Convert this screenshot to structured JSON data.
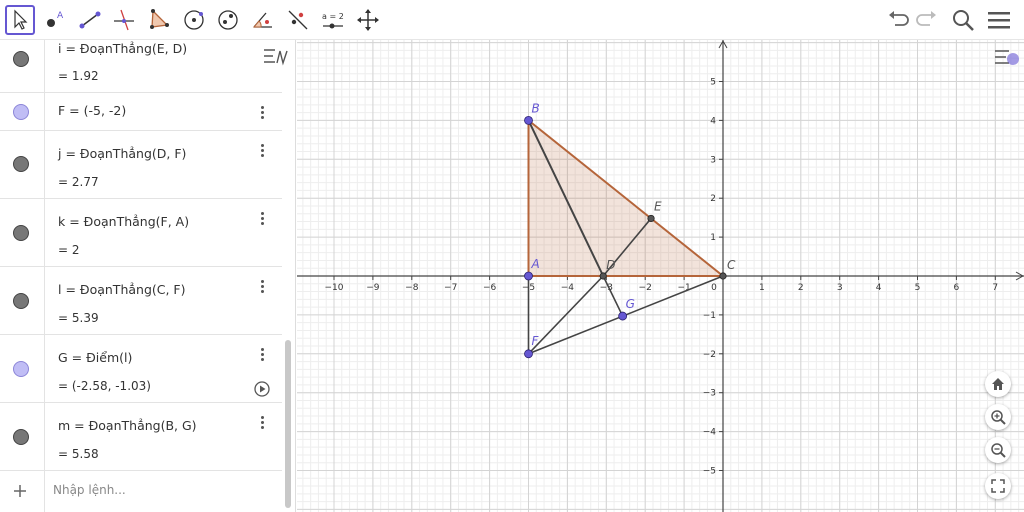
{
  "toolbar": {
    "tools": [
      "move-tool",
      "point-tool",
      "segment-tool",
      "perpendicular-line-tool",
      "polygon-tool",
      "circle-tool",
      "ellipse-tool",
      "angle-tool",
      "reflect-tool",
      "slider-tool",
      "move-graphics-tool"
    ],
    "slider_label": "a = 2"
  },
  "algebra": {
    "rows": [
      {
        "def": "i = ĐoạnThẳng(E, D)",
        "val": "= 1.92",
        "kind": "seg"
      },
      {
        "def": "F = (-5, -2)",
        "val": "",
        "kind": "pt"
      },
      {
        "def": "j = ĐoạnThẳng(D, F)",
        "val": "= 2.77",
        "kind": "seg"
      },
      {
        "def": "k = ĐoạnThẳng(F, A)",
        "val": "= 2",
        "kind": "seg"
      },
      {
        "def": "l = ĐoạnThẳng(C, F)",
        "val": "= 5.39",
        "kind": "seg"
      },
      {
        "def": "G = Điểm(l)",
        "val": "= (-2.58, -1.03)",
        "kind": "pt"
      },
      {
        "def": "m = ĐoạnThẳng(B, G)",
        "val": "= 5.58",
        "kind": "seg"
      }
    ],
    "input_placeholder": "Nhập lệnh..."
  },
  "graphics": {
    "x_ticks": [
      "−10",
      "−9",
      "−8",
      "−7",
      "−6",
      "−5",
      "−4",
      "−3",
      "−2",
      "−1",
      "0",
      "1",
      "2",
      "3",
      "4",
      "5",
      "6",
      "7"
    ],
    "y_ticks": [
      "5",
      "4",
      "3",
      "2",
      "1",
      "−1",
      "−2",
      "−3",
      "−4",
      "−5"
    ],
    "points": [
      {
        "label": "A",
        "x": -5,
        "y": 0,
        "style": "free"
      },
      {
        "label": "B",
        "x": -5,
        "y": 4,
        "style": "free"
      },
      {
        "label": "C",
        "x": 0,
        "y": 0,
        "style": "dep"
      },
      {
        "label": "D",
        "x": -3.08,
        "y": 0,
        "style": "dep"
      },
      {
        "label": "E",
        "x": -1.85,
        "y": 1.48,
        "style": "dep"
      },
      {
        "label": "F",
        "x": -5,
        "y": -2,
        "style": "free"
      },
      {
        "label": "G",
        "x": -2.58,
        "y": -1.03,
        "style": "free"
      }
    ],
    "triangle_color": "#b5653a",
    "segment_color": "#444444",
    "point_color": "#6557d2"
  }
}
